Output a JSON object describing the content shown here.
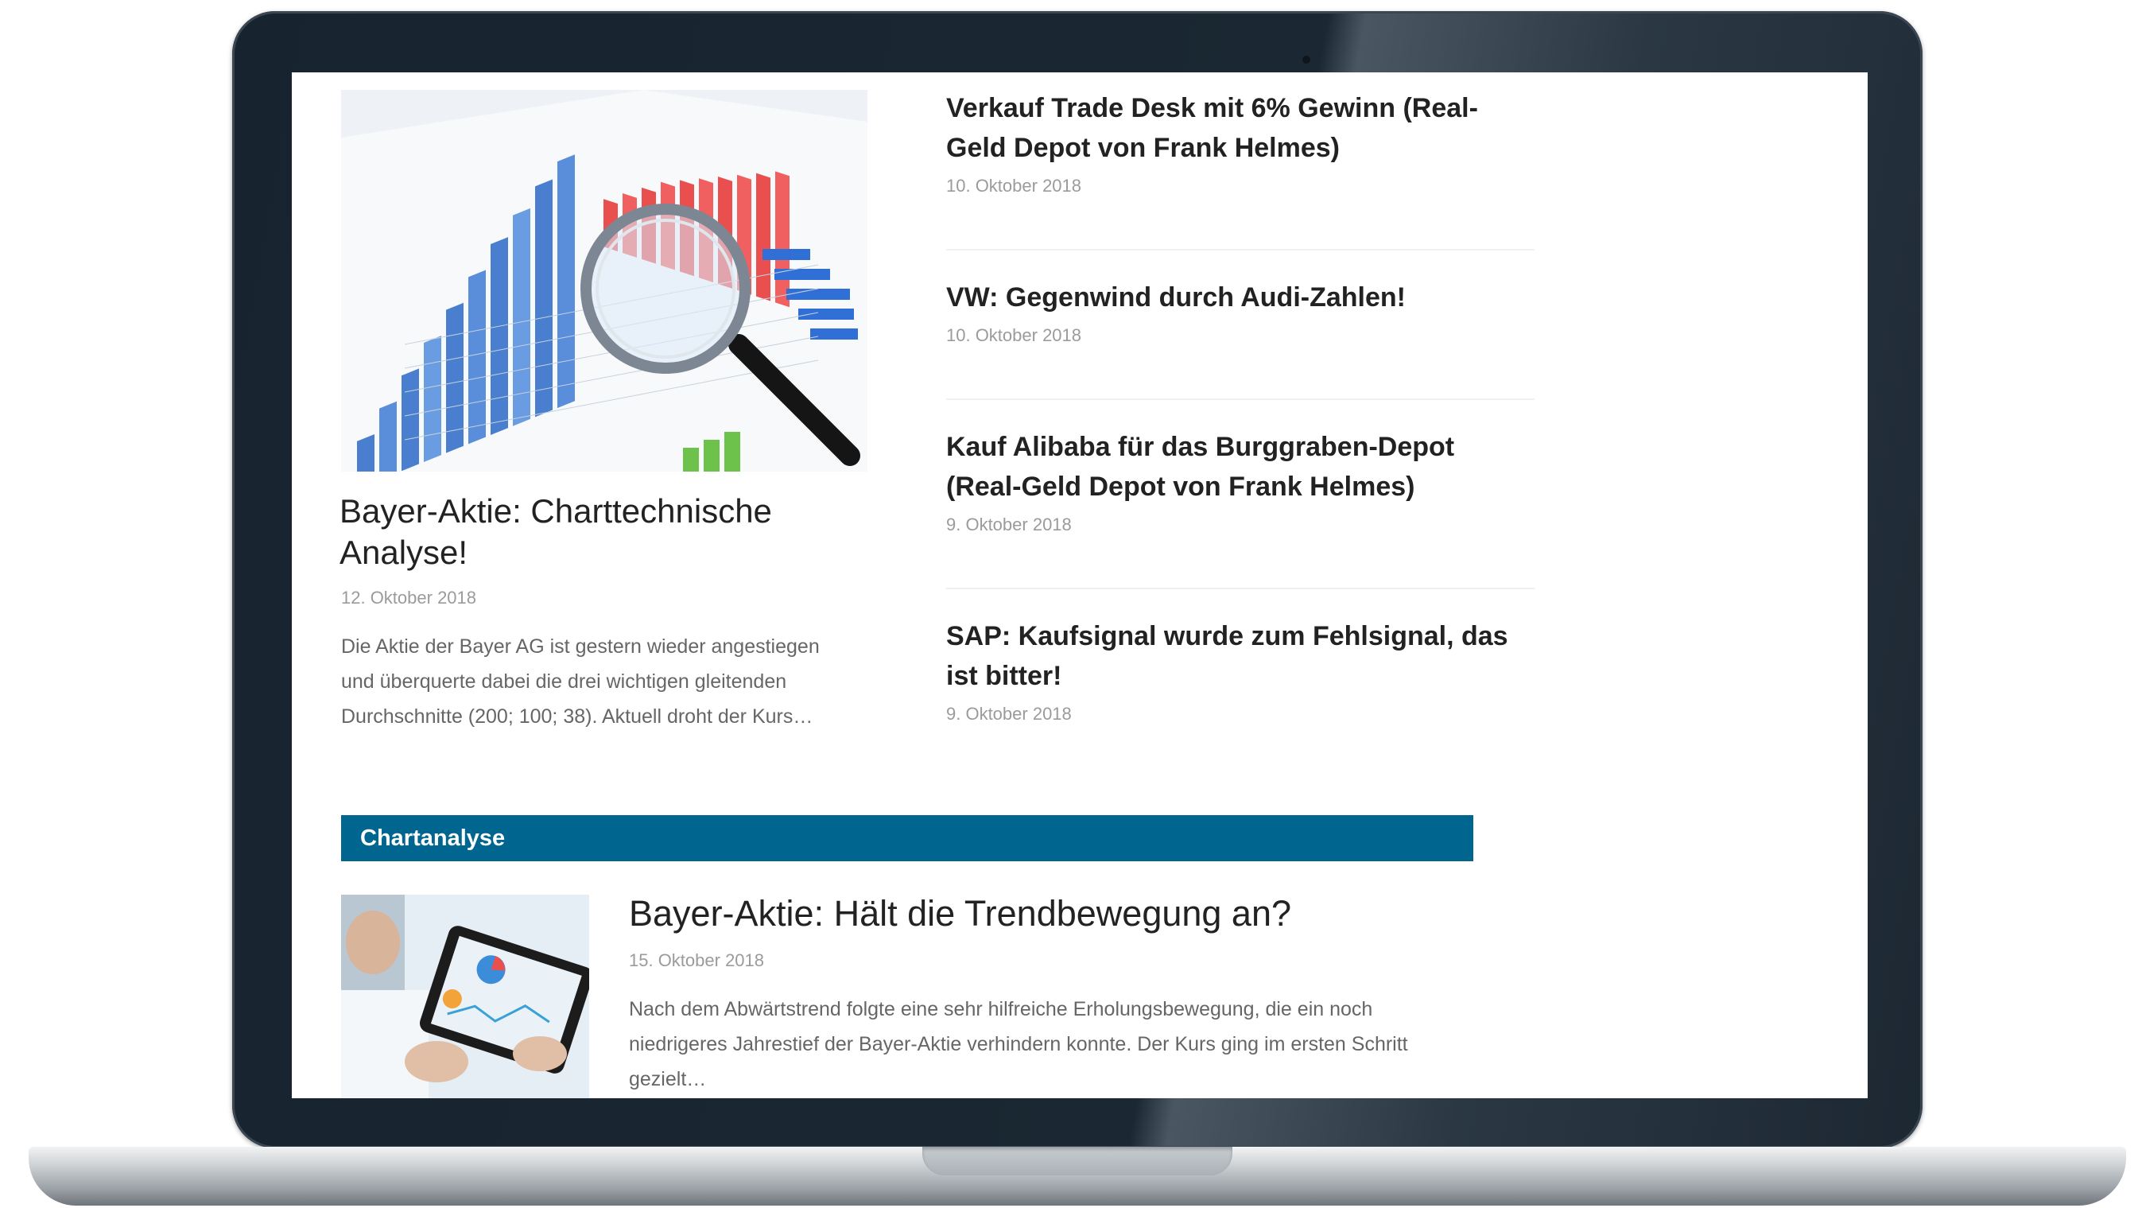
{
  "featured": {
    "title": "Bayer-Aktie: Charttechnische Analyse!",
    "date": "12. Oktober 2018",
    "excerpt": "Die Aktie der Bayer AG ist gestern wieder angestiegen und überquerte dabei die drei wichtigen gleitenden Durchschnitte (200; 100; 38). Aktuell droht der Kurs…",
    "image_icon": "chart-magnifier-image"
  },
  "side_list": [
    {
      "title": "Verkauf Trade Desk mit 6% Gewinn (Real-Geld Depot von Frank Helmes)",
      "date": "10. Oktober 2018"
    },
    {
      "title": "VW: Gegenwind durch Audi-Zahlen!",
      "date": "10. Oktober 2018"
    },
    {
      "title": "Kauf Alibaba für das Burggraben-Depot (Real-Geld Depot von Frank Helmes)",
      "date": "9. Oktober 2018"
    },
    {
      "title": "SAP: Kaufsignal wurde zum Fehlsignal, das ist bitter!",
      "date": "9. Oktober 2018"
    }
  ],
  "category": {
    "label": "Chartanalyse",
    "color": "#00668f"
  },
  "article": {
    "title": "Bayer-Aktie: Hält die Trendbewegung an?",
    "date": "15. Oktober 2018",
    "excerpt": "Nach dem Abwärtstrend folgte eine sehr hilfreiche Erholungsbewegung, die ein noch niedrigeres Jahrestief der Bayer-Aktie verhindern konnte. Der Kurs ging im ersten Schritt gezielt…",
    "image_icon": "tablet-chart-image"
  }
}
